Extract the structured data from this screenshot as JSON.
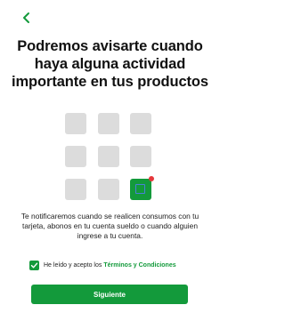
{
  "header": {
    "back_icon": "chevron-left-icon"
  },
  "hero": {
    "title": "Podremos avisarte cuando haya alguna actividad importante en tus productos"
  },
  "illustration": {
    "active_tile_icon": "app-square-icon",
    "notification_dot_icon": "notification-dot-icon",
    "colors": {
      "tile": "#dcdcdc",
      "active": "#139a3b",
      "dot": "#e5383b",
      "inner_border": "#4a7fd8"
    }
  },
  "body": {
    "description": "Te notificaremos cuando se realicen consumos con tu tarjeta, abonos en tu cuenta sueldo o cuando alguien ingrese a tu cuenta."
  },
  "consent": {
    "checked": true,
    "label_prefix": "He leído y acepto los ",
    "link_text": "Términos y Condiciones"
  },
  "actions": {
    "primary_label": "Siguiente"
  },
  "theme": {
    "accent": "#139a3b",
    "text": "#111111"
  }
}
